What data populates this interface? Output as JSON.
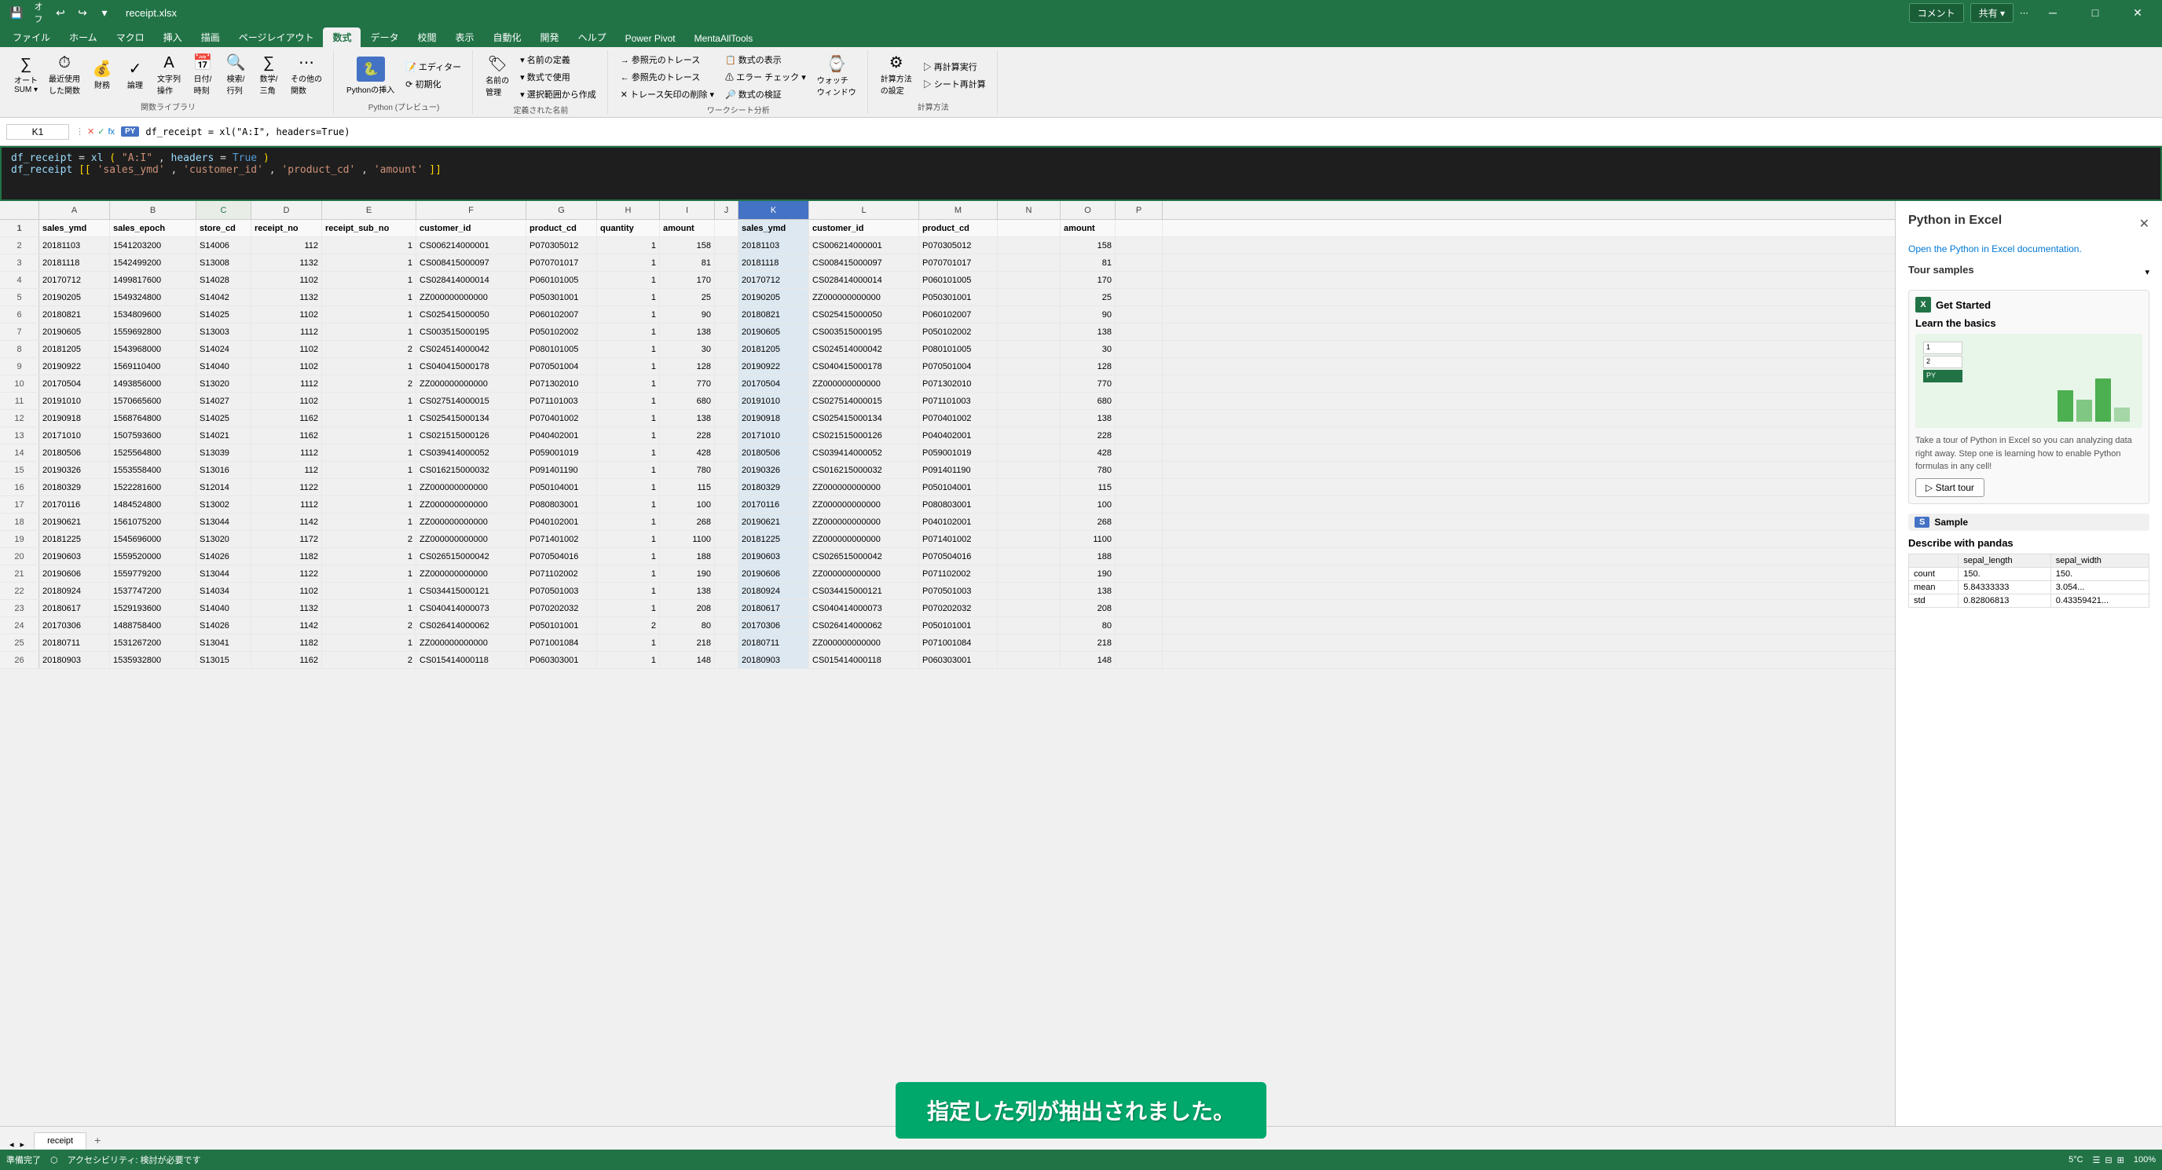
{
  "titlebar": {
    "save_label": "保存",
    "filename": "receipt.xlsx",
    "minimize": "─",
    "maximize": "□",
    "close": "✕"
  },
  "ribbon": {
    "tabs": [
      "ファイル",
      "ホーム",
      "マクロ",
      "挿入",
      "描画",
      "ページレイアウト",
      "数式",
      "データ",
      "校閲",
      "表示",
      "自動化",
      "開発",
      "ヘルプ",
      "Power Pivot",
      "MentaAllTools"
    ],
    "active_tab": "数式",
    "groups": {
      "function_library": "関数ライブラリ",
      "defined_names": "定義された名前",
      "formula_auditing": "ワークシート分析",
      "calculation": "計算方法",
      "python": "Python (プレビュー)"
    },
    "buttons": {
      "sum": "オートSUM",
      "recently_used": "最近使用した関数",
      "financial": "財務",
      "logical": "論理",
      "text": "文字列操作",
      "datetime": "日付/時刻",
      "lookup": "検索/行列",
      "math": "数学/三角",
      "more": "その他の関数",
      "python_insert": "Pythonの挿入",
      "name_manager": "名前の管理",
      "define_name": "名前の定義",
      "use_in_formula": "数式で使用",
      "create_from": "選択範囲から作成",
      "trace_precedents": "参照元のトレース",
      "trace_dependents": "参照先のトレース",
      "remove_arrows": "トレース矢印の削除",
      "show_formulas": "数式の表示",
      "error_check": "エラー チェック",
      "evaluate": "数式の検証",
      "watch": "ウォッチ ウィンドウ",
      "calc_options": "計算方法の設定",
      "calc_now": "再計算実行",
      "calc_sheet": "シート再計算",
      "initialize": "初期化",
      "editor": "エディター"
    }
  },
  "formula_bar": {
    "cell_ref": "K1",
    "py_label": "PY",
    "formula_line1": "df_receipt = xl(\"A:I\", headers=True)",
    "formula_line2": "df_receipt[['sales_ymd', 'customer_id', 'product_cd', 'amount']]"
  },
  "columns": {
    "main": [
      {
        "id": "A",
        "label": "A",
        "width": 90
      },
      {
        "id": "B",
        "label": "B",
        "width": 110
      },
      {
        "id": "C",
        "label": "C",
        "width": 70
      },
      {
        "id": "D",
        "label": "D",
        "width": 90
      },
      {
        "id": "E",
        "label": "E",
        "width": 120
      },
      {
        "id": "F",
        "label": "F",
        "width": 140
      },
      {
        "id": "G",
        "label": "G",
        "width": 90
      },
      {
        "id": "H",
        "label": "H",
        "width": 80
      },
      {
        "id": "I",
        "label": "I",
        "width": 70
      },
      {
        "id": "J",
        "label": "J",
        "width": 40
      },
      {
        "id": "K",
        "label": "K",
        "width": 90,
        "selected": true
      },
      {
        "id": "L",
        "label": "L",
        "width": 140
      },
      {
        "id": "M",
        "label": "M",
        "width": 100
      },
      {
        "id": "N",
        "label": "N",
        "width": 80
      },
      {
        "id": "O",
        "label": "O",
        "width": 70
      },
      {
        "id": "P",
        "label": "P",
        "width": 60
      }
    ]
  },
  "headers": {
    "row": [
      "sales_ymd",
      "sales_epoch",
      "store_cd",
      "receipt_no",
      "receipt_sub_no",
      "customer_id",
      "product_cd",
      "quantity",
      "amount",
      "",
      "sales_ymd",
      "customer_id",
      "product_cd",
      "",
      "amount",
      ""
    ]
  },
  "rows": [
    {
      "num": 2,
      "cols": [
        "20181103",
        "1541203200",
        "S14006",
        "112",
        "1",
        "CS006214000001",
        "P070305012",
        "1",
        "158",
        "",
        "20181103",
        "CS006214000001",
        "P070305012",
        "",
        "158",
        ""
      ]
    },
    {
      "num": 3,
      "cols": [
        "20181118",
        "1542499200",
        "S13008",
        "1132",
        "1",
        "CS008415000097",
        "P070701017",
        "1",
        "81",
        "",
        "20181118",
        "CS008415000097",
        "P070701017",
        "",
        "81",
        ""
      ]
    },
    {
      "num": 4,
      "cols": [
        "20170712",
        "1499817600",
        "S14028",
        "1102",
        "1",
        "CS028414000014",
        "P060101005",
        "1",
        "170",
        "",
        "20170712",
        "CS028414000014",
        "P060101005",
        "",
        "170",
        ""
      ]
    },
    {
      "num": 5,
      "cols": [
        "20190205",
        "1549324800",
        "S14042",
        "1132",
        "1",
        "ZZ000000000000",
        "P050301001",
        "1",
        "25",
        "",
        "20190205",
        "ZZ000000000000",
        "P050301001",
        "",
        "25",
        ""
      ]
    },
    {
      "num": 6,
      "cols": [
        "20180821",
        "1534809600",
        "S14025",
        "1102",
        "1",
        "CS025415000050",
        "P060102007",
        "1",
        "90",
        "",
        "20180821",
        "CS025415000050",
        "P060102007",
        "",
        "90",
        ""
      ]
    },
    {
      "num": 7,
      "cols": [
        "20190605",
        "1559692800",
        "S13003",
        "1112",
        "1",
        "CS003515000195",
        "P050102002",
        "1",
        "138",
        "",
        "20190605",
        "CS003515000195",
        "P050102002",
        "",
        "138",
        ""
      ]
    },
    {
      "num": 8,
      "cols": [
        "20181205",
        "1543968000",
        "S14024",
        "1102",
        "2",
        "CS024514000042",
        "P080101005",
        "1",
        "30",
        "",
        "20181205",
        "CS024514000042",
        "P080101005",
        "",
        "30",
        ""
      ]
    },
    {
      "num": 9,
      "cols": [
        "20190922",
        "1569110400",
        "S14040",
        "1102",
        "1",
        "CS040415000178",
        "P070501004",
        "1",
        "128",
        "",
        "20190922",
        "CS040415000178",
        "P070501004",
        "",
        "128",
        ""
      ]
    },
    {
      "num": 10,
      "cols": [
        "20170504",
        "1493856000",
        "S13020",
        "1112",
        "2",
        "ZZ000000000000",
        "P071302010",
        "1",
        "770",
        "",
        "20170504",
        "ZZ000000000000",
        "P071302010",
        "",
        "770",
        ""
      ]
    },
    {
      "num": 11,
      "cols": [
        "20191010",
        "1570665600",
        "S14027",
        "1102",
        "1",
        "CS027514000015",
        "P071101003",
        "1",
        "680",
        "",
        "20191010",
        "CS027514000015",
        "P071101003",
        "",
        "680",
        ""
      ]
    },
    {
      "num": 12,
      "cols": [
        "20190918",
        "1568764800",
        "S14025",
        "1162",
        "1",
        "CS025415000134",
        "P070401002",
        "1",
        "138",
        "",
        "20190918",
        "CS025415000134",
        "P070401002",
        "",
        "138",
        ""
      ]
    },
    {
      "num": 13,
      "cols": [
        "20171010",
        "1507593600",
        "S14021",
        "1162",
        "1",
        "CS021515000126",
        "P040402001",
        "1",
        "228",
        "",
        "20171010",
        "CS021515000126",
        "P040402001",
        "",
        "228",
        ""
      ]
    },
    {
      "num": 14,
      "cols": [
        "20180506",
        "1525564800",
        "S13039",
        "1112",
        "1",
        "CS039414000052",
        "P059001019",
        "1",
        "428",
        "",
        "20180506",
        "CS039414000052",
        "P059001019",
        "",
        "428",
        ""
      ]
    },
    {
      "num": 15,
      "cols": [
        "20190326",
        "1553558400",
        "S13016",
        "112",
        "1",
        "CS016215000032",
        "P091401190",
        "1",
        "780",
        "",
        "20190326",
        "CS016215000032",
        "P091401190",
        "",
        "780",
        ""
      ]
    },
    {
      "num": 16,
      "cols": [
        "20180329",
        "1522281600",
        "S12014",
        "1122",
        "1",
        "ZZ000000000000",
        "P050104001",
        "1",
        "115",
        "",
        "20180329",
        "ZZ000000000000",
        "P050104001",
        "",
        "115",
        ""
      ]
    },
    {
      "num": 17,
      "cols": [
        "20170116",
        "1484524800",
        "S13002",
        "1112",
        "1",
        "ZZ000000000000",
        "P080803001",
        "1",
        "100",
        "",
        "20170116",
        "ZZ000000000000",
        "P080803001",
        "",
        "100",
        ""
      ]
    },
    {
      "num": 18,
      "cols": [
        "20190621",
        "1561075200",
        "S13044",
        "1142",
        "1",
        "ZZ000000000000",
        "P040102001",
        "1",
        "268",
        "",
        "20190621",
        "ZZ000000000000",
        "P040102001",
        "",
        "268",
        ""
      ]
    },
    {
      "num": 19,
      "cols": [
        "20181225",
        "1545696000",
        "S13020",
        "1172",
        "2",
        "ZZ000000000000",
        "P071401002",
        "1",
        "1100",
        "",
        "20181225",
        "ZZ000000000000",
        "P071401002",
        "",
        "1100",
        ""
      ]
    },
    {
      "num": 20,
      "cols": [
        "20190603",
        "1559520000",
        "S14026",
        "1182",
        "1",
        "CS026515000042",
        "P070504016",
        "1",
        "188",
        "",
        "20190603",
        "CS026515000042",
        "P070504016",
        "",
        "188",
        ""
      ]
    },
    {
      "num": 21,
      "cols": [
        "20190606",
        "1559779200",
        "S13044",
        "1122",
        "1",
        "ZZ000000000000",
        "P071102002",
        "1",
        "190",
        "",
        "20190606",
        "ZZ000000000000",
        "P071102002",
        "",
        "190",
        ""
      ]
    },
    {
      "num": 22,
      "cols": [
        "20180924",
        "1537747200",
        "S14034",
        "1102",
        "1",
        "CS034415000121",
        "P070501003",
        "1",
        "138",
        "",
        "20180924",
        "CS034415000121",
        "P070501003",
        "",
        "138",
        ""
      ]
    },
    {
      "num": 23,
      "cols": [
        "20180617",
        "1529193600",
        "S14040",
        "1132",
        "1",
        "CS040414000073",
        "P070202032",
        "1",
        "208",
        "",
        "20180617",
        "CS040414000073",
        "P070202032",
        "",
        "208",
        ""
      ]
    },
    {
      "num": 24,
      "cols": [
        "20170306",
        "1488758400",
        "S14026",
        "1142",
        "2",
        "CS026414000062",
        "P050101001",
        "2",
        "80",
        "",
        "20170306",
        "CS026414000062",
        "P050101001",
        "",
        "80",
        ""
      ]
    },
    {
      "num": 25,
      "cols": [
        "20180711",
        "1531267200",
        "S13041",
        "1182",
        "1",
        "ZZ000000000000",
        "P071001084",
        "1",
        "218",
        "",
        "20180711",
        "ZZ000000000000",
        "P071001084",
        "",
        "218",
        ""
      ]
    },
    {
      "num": 26,
      "cols": [
        "20180903",
        "1535932800",
        "S13015",
        "1162",
        "2",
        "CS015414000118",
        "P060303001",
        "1",
        "148",
        "",
        "20180903",
        "CS015414000118",
        "P060303001",
        "",
        "148",
        ""
      ]
    }
  ],
  "python_sidebar": {
    "title": "Python in Excel",
    "doc_link": "Open the Python in Excel documentation.",
    "tour_samples_label": "Tour samples",
    "get_started": "Get Started",
    "learn_basics": "Learn the basics",
    "tour_desc": "Take a tour of Python in Excel so you can analyzing data right away. Step one is learning how to enable Python formulas in any cell!",
    "start_tour": "▷  Start tour",
    "sample_label": "Sample",
    "pandas_title": "Describe with pandas",
    "pandas_table": {
      "headers": [
        "",
        "sepal_length",
        "sepal_width"
      ],
      "rows": [
        [
          "count",
          "150.",
          "150."
        ],
        [
          "mean",
          "5.84333333",
          "3.054..."
        ],
        [
          "std",
          "0.82806813",
          "0.43359421..."
        ]
      ]
    }
  },
  "status_bar": {
    "ready": "準備完了",
    "accessibility": "アクセシビリティ: 検討が必要です",
    "cell_mode": "",
    "sheet_views": "",
    "zoom": "100%",
    "temp": "5°C"
  },
  "sheet_tabs": {
    "tabs": [
      "receipt"
    ],
    "active": "receipt"
  },
  "notification": {
    "text": "指定した列が抽出されました。"
  }
}
